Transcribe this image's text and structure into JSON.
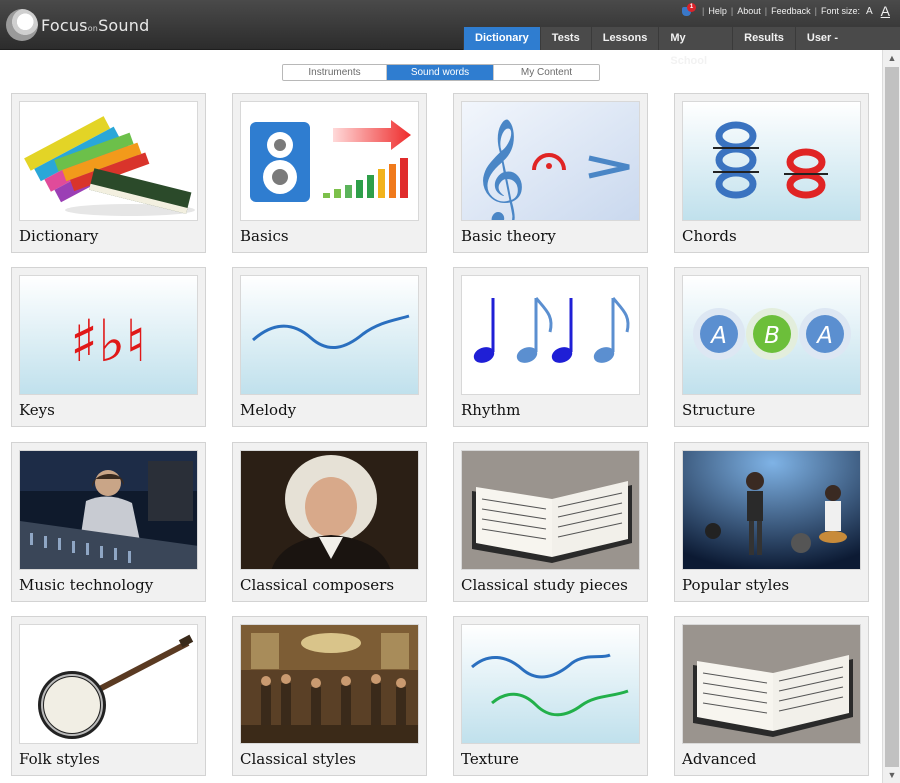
{
  "app": {
    "logo_main": "Focus",
    "logo_small": "on",
    "logo_end": "Sound",
    "notification_count": "1"
  },
  "toplinks": {
    "help": "Help",
    "about": "About",
    "feedback": "Feedback",
    "font_size": "Font size:",
    "font_small": "A",
    "font_large": "A"
  },
  "nav": {
    "tabs": [
      {
        "label": "Dictionary"
      },
      {
        "label": "Tests"
      },
      {
        "label": "Lessons"
      },
      {
        "label": "My School"
      },
      {
        "label": "Results"
      },
      {
        "label": "User -"
      }
    ],
    "active": "Dictionary"
  },
  "segments": {
    "items": [
      {
        "label": "Instruments"
      },
      {
        "label": "Sound words"
      },
      {
        "label": "My Content"
      }
    ],
    "active": "Sound words"
  },
  "cards": [
    {
      "label": "Dictionary",
      "icon": "books-icon"
    },
    {
      "label": "Basics",
      "icon": "speaker-volume-icon"
    },
    {
      "label": "Basic theory",
      "icon": "treble-clef-icon"
    },
    {
      "label": "Chords",
      "icon": "chord-notes-icon"
    },
    {
      "label": "Keys",
      "icon": "sharp-flat-natural-icon"
    },
    {
      "label": "Melody",
      "icon": "melody-wave-icon"
    },
    {
      "label": "Rhythm",
      "icon": "eighth-notes-icon"
    },
    {
      "label": "Structure",
      "icon": "aba-form-icon"
    },
    {
      "label": "Music technology",
      "icon": "mixing-desk-photo"
    },
    {
      "label": "Classical composers",
      "icon": "composer-portrait-photo"
    },
    {
      "label": "Classical study pieces",
      "icon": "open-score-book-photo"
    },
    {
      "label": "Popular styles",
      "icon": "rock-band-photo"
    },
    {
      "label": "Folk styles",
      "icon": "banjo-photo"
    },
    {
      "label": "Classical styles",
      "icon": "baroque-concert-painting"
    },
    {
      "label": "Texture",
      "icon": "texture-waves-icon"
    },
    {
      "label": "Advanced",
      "icon": "open-score-book-photo"
    }
  ],
  "colors": {
    "accent": "#2f7dd0",
    "header": "#3a3a3a",
    "card_bg": "#f1f1f1"
  },
  "structure_letters": [
    "A",
    "B",
    "A"
  ]
}
